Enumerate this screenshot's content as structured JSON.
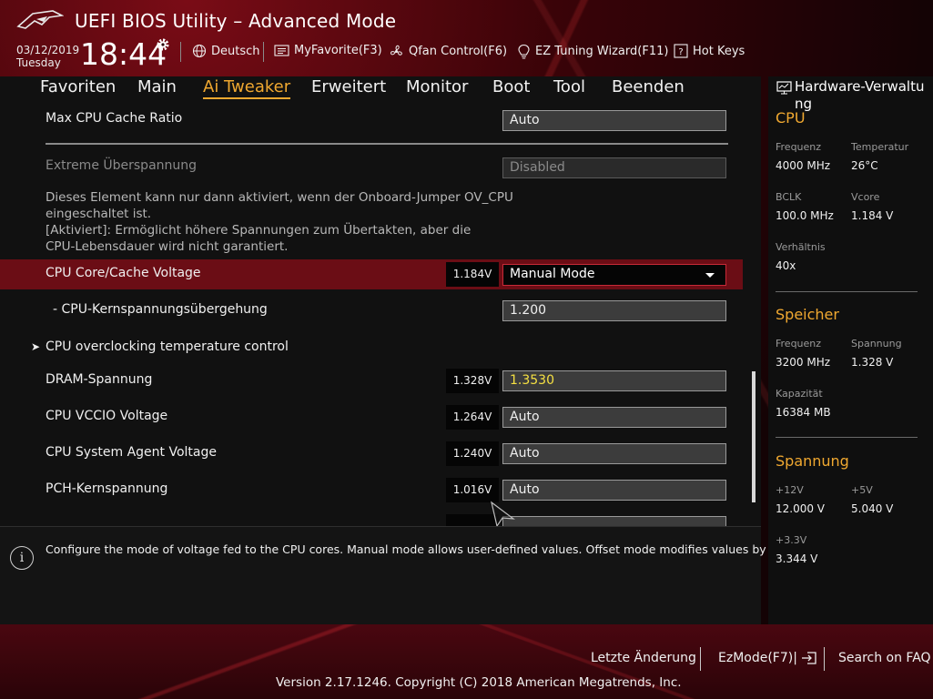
{
  "app": {
    "title": "UEFI BIOS Utility – Advanced Mode"
  },
  "header": {
    "date": "03/12/2019",
    "weekday": "Tuesday",
    "time": "18:44",
    "items": {
      "language": "Deutsch",
      "myfavorite": "MyFavorite(F3)",
      "qfan": "Qfan Control(F6)",
      "ez_tuning": "EZ Tuning Wizard(F11)",
      "hotkeys": "Hot Keys"
    }
  },
  "tabs": [
    {
      "label": "Favoriten",
      "active": false
    },
    {
      "label": "Main",
      "active": false
    },
    {
      "label": "Ai Tweaker",
      "active": true
    },
    {
      "label": "Erweitert",
      "active": false
    },
    {
      "label": "Monitor",
      "active": false
    },
    {
      "label": "Boot",
      "active": false
    },
    {
      "label": "Tool",
      "active": false
    },
    {
      "label": "Beenden",
      "active": false
    }
  ],
  "settings": {
    "max_cpu_cache_ratio": {
      "label": "Max CPU Cache Ratio",
      "value": "Auto"
    },
    "extreme_overvoltage": {
      "label": "Extreme Überspannung",
      "value": "Disabled"
    },
    "note_lines": [
      "Dieses Element kann nur dann aktiviert, wenn der Onboard-Jumper OV_CPU",
      "eingeschaltet ist.",
      "[Aktiviert]: Ermöglicht höhere Spannungen zum Übertakten, aber die",
      "CPU-Lebensdauer wird nicht garantiert."
    ],
    "cpu_core_cache_voltage": {
      "label": "CPU Core/Cache Voltage",
      "reading": "1.184V",
      "value": "Manual Mode"
    },
    "cpu_core_override": {
      "label": "- CPU-Kernspannungsübergehung",
      "value": "1.200"
    },
    "cpu_oc_temp_control": {
      "label": "CPU overclocking temperature control"
    },
    "dram_voltage": {
      "label": "DRAM-Spannung",
      "reading": "1.328V",
      "value": "1.3530"
    },
    "cpu_vccio": {
      "label": "CPU VCCIO Voltage",
      "reading": "1.264V",
      "value": "Auto"
    },
    "cpu_sa": {
      "label": "CPU System Agent Voltage",
      "reading": "1.240V",
      "value": "Auto"
    },
    "pch_core": {
      "label": "PCH-Kernspannung",
      "reading": "1.016V",
      "value": "Auto"
    }
  },
  "help": {
    "text": "Configure the mode of voltage fed to the CPU cores. Manual mode allows user-defined values. Offset mode modifies values by SVID."
  },
  "monitor": {
    "title": "Hardware-Verwaltung",
    "title_line1": "Hardware-Verwaltu",
    "title_line2": "ng",
    "cpu": {
      "heading": "CPU",
      "freq_label": "Frequenz",
      "freq_value": "4000 MHz",
      "temp_label": "Temperatur",
      "temp_value": "26°C",
      "bclk_label": "BCLK",
      "bclk_value": "100.0 MHz",
      "vcore_label": "Vcore",
      "vcore_value": "1.184 V",
      "ratio_label": "Verhältnis",
      "ratio_value": "40x"
    },
    "memory": {
      "heading": "Speicher",
      "freq_label": "Frequenz",
      "freq_value": "3200 MHz",
      "volt_label": "Spannung",
      "volt_value": "1.328 V",
      "cap_label": "Kapazität",
      "cap_value": "16384 MB"
    },
    "voltage": {
      "heading": "Spannung",
      "v12_label": "+12V",
      "v12_value": "12.000 V",
      "v5_label": "+5V",
      "v5_value": "5.040 V",
      "v33_label": "+3.3V",
      "v33_value": "3.344 V"
    }
  },
  "bottom": {
    "last_change": "Letzte Änderung",
    "ezmode": "EzMode(F7)|",
    "search_faq": "Search on FAQ",
    "version": "Version 2.17.1246. Copyright (C) 2018 American Megatrends, Inc."
  },
  "colors": {
    "accent": "#f0a830",
    "highlight_row": "#6b0d15",
    "value_yellow": "#f5e042"
  }
}
